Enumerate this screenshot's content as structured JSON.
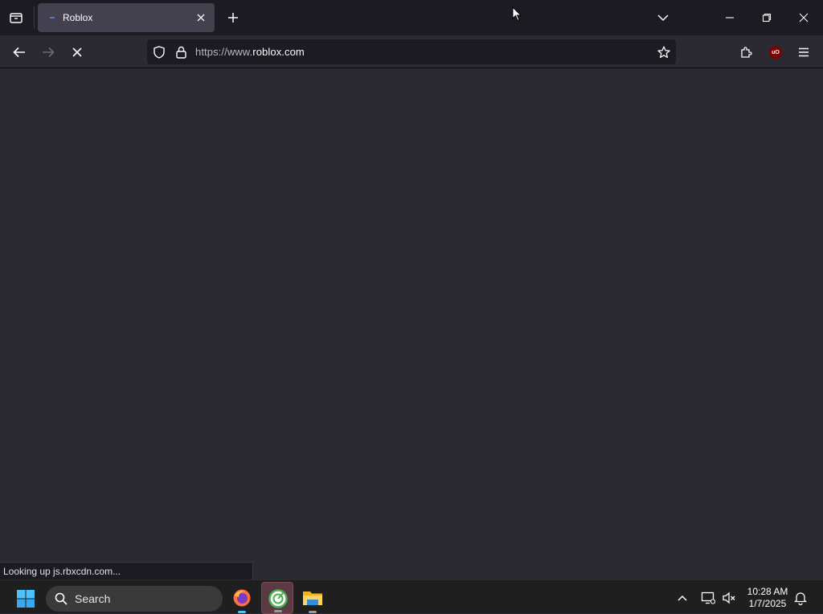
{
  "browser": {
    "tab": {
      "title": "Roblox"
    },
    "url": {
      "scheme": "https://www.",
      "host": "roblox.com"
    },
    "status_text": "Looking up js.rbxcdn.com...",
    "extension_badge": "uO"
  },
  "icons": {
    "tab_list": "tab-list-icon",
    "new_tab": "plus-icon",
    "list_all_tabs": "chevron-down-icon",
    "minimize": "minimize-icon",
    "restore": "restore-icon",
    "close_window": "close-icon",
    "back": "back-arrow-icon",
    "forward": "forward-arrow-icon",
    "stop": "stop-icon",
    "tracking_protection": "shield-icon",
    "site_security": "lock-icon",
    "bookmark": "star-icon",
    "extensions": "puzzle-icon",
    "menu": "hamburger-icon"
  },
  "taskbar": {
    "search_label": "Search",
    "time": "10:28 AM",
    "date": "1/7/2025",
    "apps": [
      "firefox",
      "app-green",
      "file-explorer"
    ]
  },
  "colors": {
    "tab_bar": "#1c1b22",
    "toolbar": "#2b2a33",
    "active_tab": "#42414d",
    "urlbar": "#1c1b22",
    "taskbar": "#1f1f1f",
    "windows_accent": "#4cc2ff"
  }
}
